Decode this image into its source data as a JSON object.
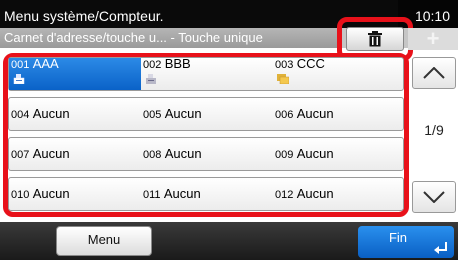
{
  "header": {
    "title": "Menu système/Compteur.",
    "time": "10:10",
    "subtitle": "Carnet d'adresse/touche u... - Touche unique"
  },
  "toolbar": {
    "delete_icon": "trash-icon",
    "add_icon": "plus-icon"
  },
  "grid": {
    "rows": [
      [
        {
          "num": "001",
          "name": "AAA",
          "icon": "fax-icon",
          "selected": true
        },
        {
          "num": "002",
          "name": "BBB",
          "icon": "fax-icon",
          "selected": false
        },
        {
          "num": "003",
          "name": "CCC",
          "icon": "group-icon",
          "selected": false
        }
      ],
      [
        {
          "num": "004",
          "name": "Aucun"
        },
        {
          "num": "005",
          "name": "Aucun"
        },
        {
          "num": "006",
          "name": "Aucun"
        }
      ],
      [
        {
          "num": "007",
          "name": "Aucun"
        },
        {
          "num": "008",
          "name": "Aucun"
        },
        {
          "num": "009",
          "name": "Aucun"
        }
      ],
      [
        {
          "num": "010",
          "name": "Aucun"
        },
        {
          "num": "011",
          "name": "Aucun"
        },
        {
          "num": "012",
          "name": "Aucun"
        }
      ]
    ]
  },
  "pagination": {
    "page": "1/9",
    "up_icon": "chevron-up-icon",
    "down_icon": "chevron-down-icon"
  },
  "footer": {
    "menu_label": "Menu",
    "fin_label": "Fin",
    "enter_icon": "enter-icon"
  },
  "colors": {
    "highlight": "#e8111a",
    "selected": "#0a62c8",
    "accent": "#1a7ad8"
  }
}
